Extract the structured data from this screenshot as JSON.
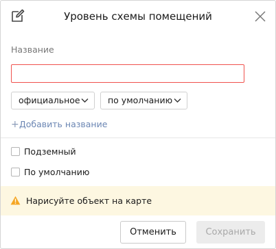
{
  "header": {
    "title": "Уровень схемы помещений",
    "edit_icon": "edit-icon",
    "close_icon": "close-icon"
  },
  "name_section": {
    "label": "Название",
    "input_value": "",
    "input_placeholder": "",
    "type_select": {
      "selected": "официальное"
    },
    "lang_select": {
      "selected": "по умолчанию"
    },
    "add_name_label": "Добавить название"
  },
  "options": {
    "underground": {
      "label": "Подземный",
      "checked": false
    },
    "default": {
      "label": "По умолчанию",
      "checked": false
    }
  },
  "warning": {
    "icon": "warning-icon",
    "text": "Нарисуйте объект на карте"
  },
  "footer": {
    "cancel_label": "Отменить",
    "save_label": "Сохранить",
    "save_enabled": false
  },
  "colors": {
    "error_border": "#f0504b",
    "link": "#6b86b3",
    "warning_bg": "#fdf7e1",
    "warning_icon": "#f5a623",
    "disabled_button_bg": "#ececec"
  }
}
